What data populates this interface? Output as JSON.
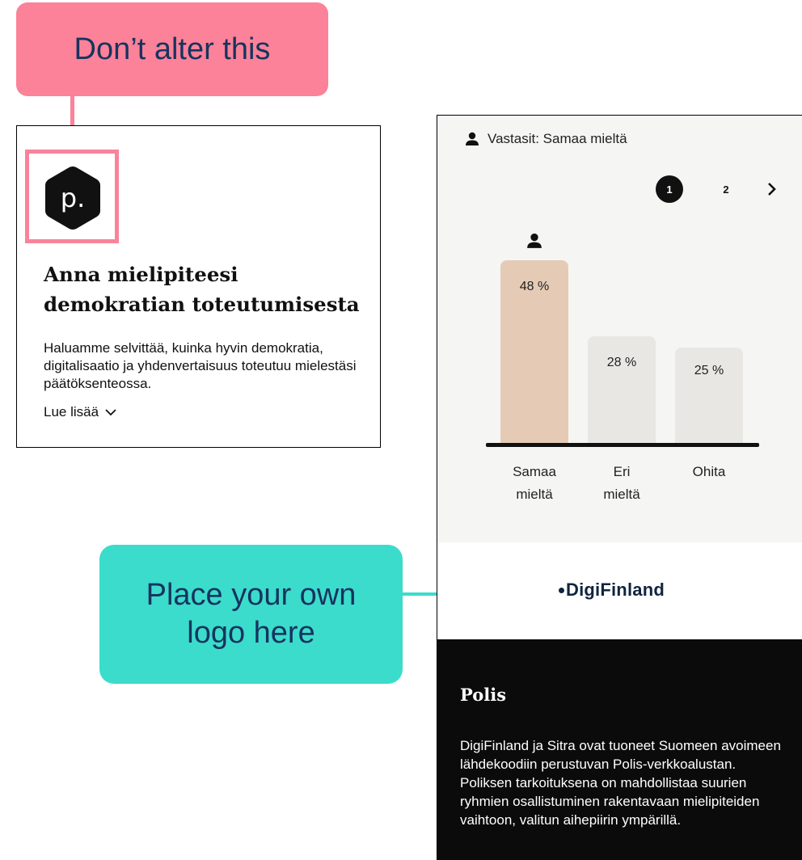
{
  "annotations": {
    "dont_alter": "Don’t alter this",
    "place_logo": "Place your own logo here"
  },
  "left_card": {
    "logo_letter": "p.",
    "title": "Anna mielipiteesi demokratian toteutumisesta",
    "description": "Haluamme selvittää, kuinka hyvin demokratia, digitalisaatio ja yhdenvertaisuus toteutuu mielestäsi päätöksenteossa.",
    "read_more": "Lue lisää"
  },
  "phone": {
    "answered": "Vastasit: Samaa mieltä",
    "pager": {
      "page1": "1",
      "page2": "2"
    },
    "brand": "DigiFinland",
    "footer": {
      "title": "Polis",
      "text": "DigiFinland ja Sitra ovat tuoneet Suomeen avoimeen lähdekoodiin perustuvan Polis-verkkoalustan. Poliksen tarkoituksena on mahdollistaa suurien ryhmien osallistuminen rakentavaan mielipiteiden vaihtoon, valitun aihepiirin ympärillä."
    }
  },
  "colors": {
    "pink": "#fb8298",
    "teal": "#3bdccb",
    "navy_text": "#17335f",
    "bar_selected": "#e5cbb6",
    "bar_other": "#e8e7e3"
  },
  "chart_data": {
    "type": "bar",
    "categories": [
      "Samaa mieltä",
      "Eri mieltä",
      "Ohita"
    ],
    "category_lines": [
      [
        "Samaa",
        "mieltä"
      ],
      [
        "Eri",
        "mieltä"
      ],
      [
        "Ohita"
      ]
    ],
    "values": [
      48,
      28,
      25
    ],
    "value_labels": [
      "48 %",
      "28 %",
      "25 %"
    ],
    "selected_index": 0,
    "ylim": [
      0,
      48
    ]
  }
}
